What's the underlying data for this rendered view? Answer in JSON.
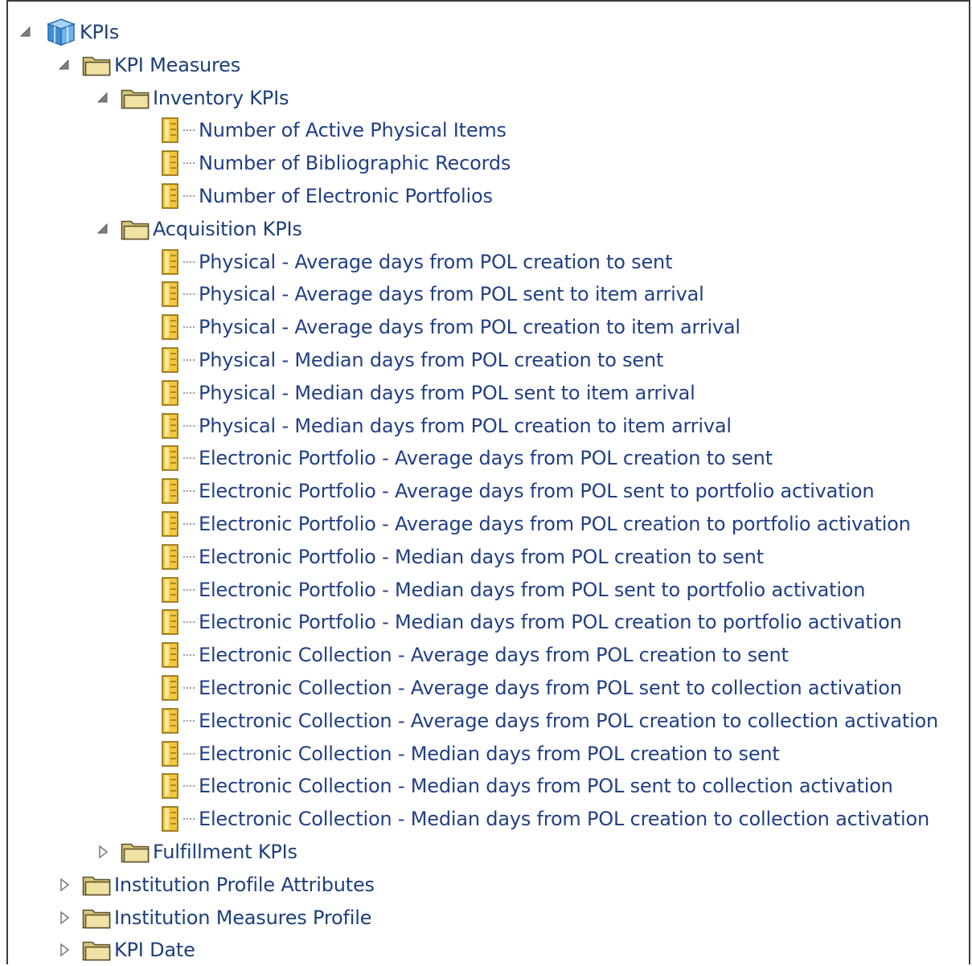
{
  "tree": {
    "root": {
      "label": "KPIs",
      "icon": "cube-icon",
      "expanded": true
    },
    "kpi_measures": {
      "label": "KPI Measures",
      "icon": "folder-icon",
      "expanded": true
    },
    "inventory": {
      "label": "Inventory KPIs",
      "icon": "folder-icon",
      "expanded": true,
      "items": [
        "Number of Active Physical Items",
        "Number of Bibliographic Records",
        "Number of Electronic Portfolios"
      ]
    },
    "acquisition": {
      "label": "Acquisition KPIs",
      "icon": "folder-icon",
      "expanded": true,
      "items": [
        "Physical - Average days from POL creation to sent",
        "Physical - Average days from POL sent to item arrival",
        "Physical - Average days from POL creation to item arrival",
        "Physical - Median days from POL creation to sent",
        "Physical - Median days from POL sent to item arrival",
        "Physical - Median days from POL creation to item arrival",
        "Electronic Portfolio - Average days from POL creation to sent",
        "Electronic Portfolio - Average days from POL sent to portfolio activation",
        "Electronic Portfolio - Average days from POL creation to portfolio activation",
        "Electronic Portfolio - Median days from POL creation to sent",
        "Electronic Portfolio - Median days from POL sent to portfolio activation",
        "Electronic Portfolio - Median days from POL creation to portfolio activation",
        "Electronic Collection - Average days from POL creation to sent",
        "Electronic Collection - Average days from POL sent to collection activation",
        "Electronic Collection - Average days from POL creation to collection activation",
        "Electronic Collection - Median days from POL creation to sent",
        "Electronic Collection - Median days from POL sent to collection activation",
        "Electronic Collection - Median days from POL creation to collection activation"
      ]
    },
    "fulfillment": {
      "label": "Fulfillment KPIs",
      "icon": "folder-icon",
      "expanded": false
    },
    "institution_profile_attributes": {
      "label": "Institution Profile Attributes",
      "icon": "folder-icon",
      "expanded": false
    },
    "institution_measures_profile": {
      "label": "Institution Measures Profile",
      "icon": "folder-icon",
      "expanded": false
    },
    "kpi_date": {
      "label": "KPI Date",
      "icon": "folder-icon",
      "expanded": false
    }
  },
  "colors": {
    "text": "#1c3f7a",
    "folder_fill": "#efe2a2",
    "folder_stroke": "#5a5030",
    "measure_fill": "#f3c63c",
    "cube_blue": "#3d8fd6"
  }
}
